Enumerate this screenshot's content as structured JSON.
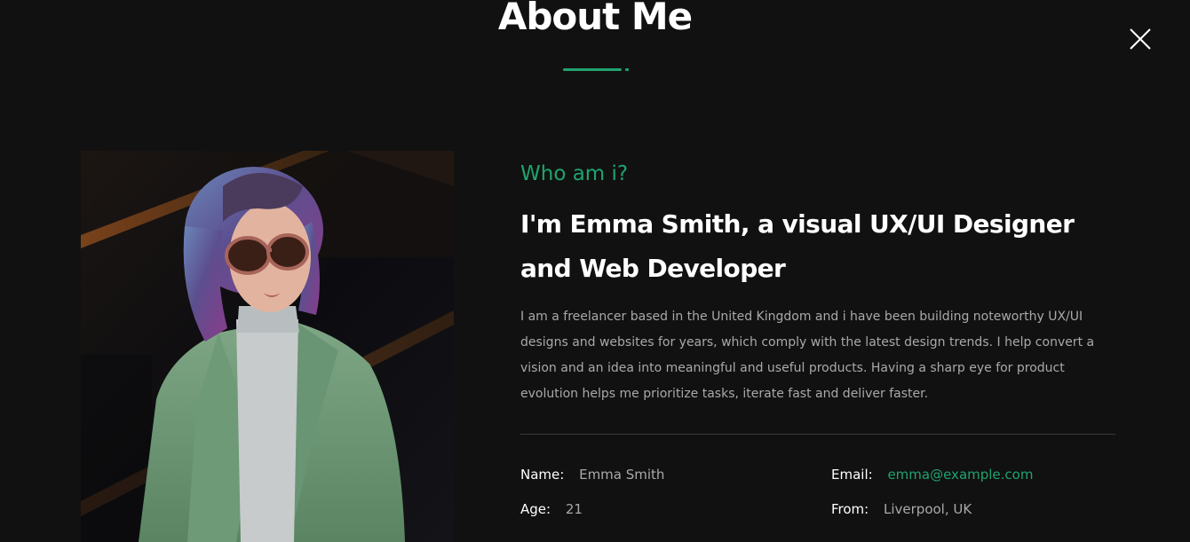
{
  "header": {
    "title": "About Me"
  },
  "close": {
    "icon": "close-icon"
  },
  "profile": {
    "kicker": "Who am i?",
    "headline": "I'm Emma Smith, a visual UX/UI Designer and Web Developer",
    "bio": "I am a freelancer based in the United Kingdom and i have been building noteworthy UX/UI designs and websites for years, which comply with the latest design trends. I help convert a vision and an idea into meaningful and useful products. Having a sharp eye for product evolution helps me prioritize tasks, iterate fast and deliver faster."
  },
  "info": {
    "name": {
      "label": "Name:",
      "value": "Emma Smith"
    },
    "email": {
      "label": "Email:",
      "value": "emma@example.com"
    },
    "age": {
      "label": "Age:",
      "value": "21"
    },
    "from": {
      "label": "From:",
      "value": "Liverpool, UK"
    }
  },
  "colors": {
    "background": "#111111",
    "accent": "#20a36e",
    "text": "#ffffff",
    "muted_text": "#a9a9a9",
    "divider": "#3a3a3a"
  }
}
